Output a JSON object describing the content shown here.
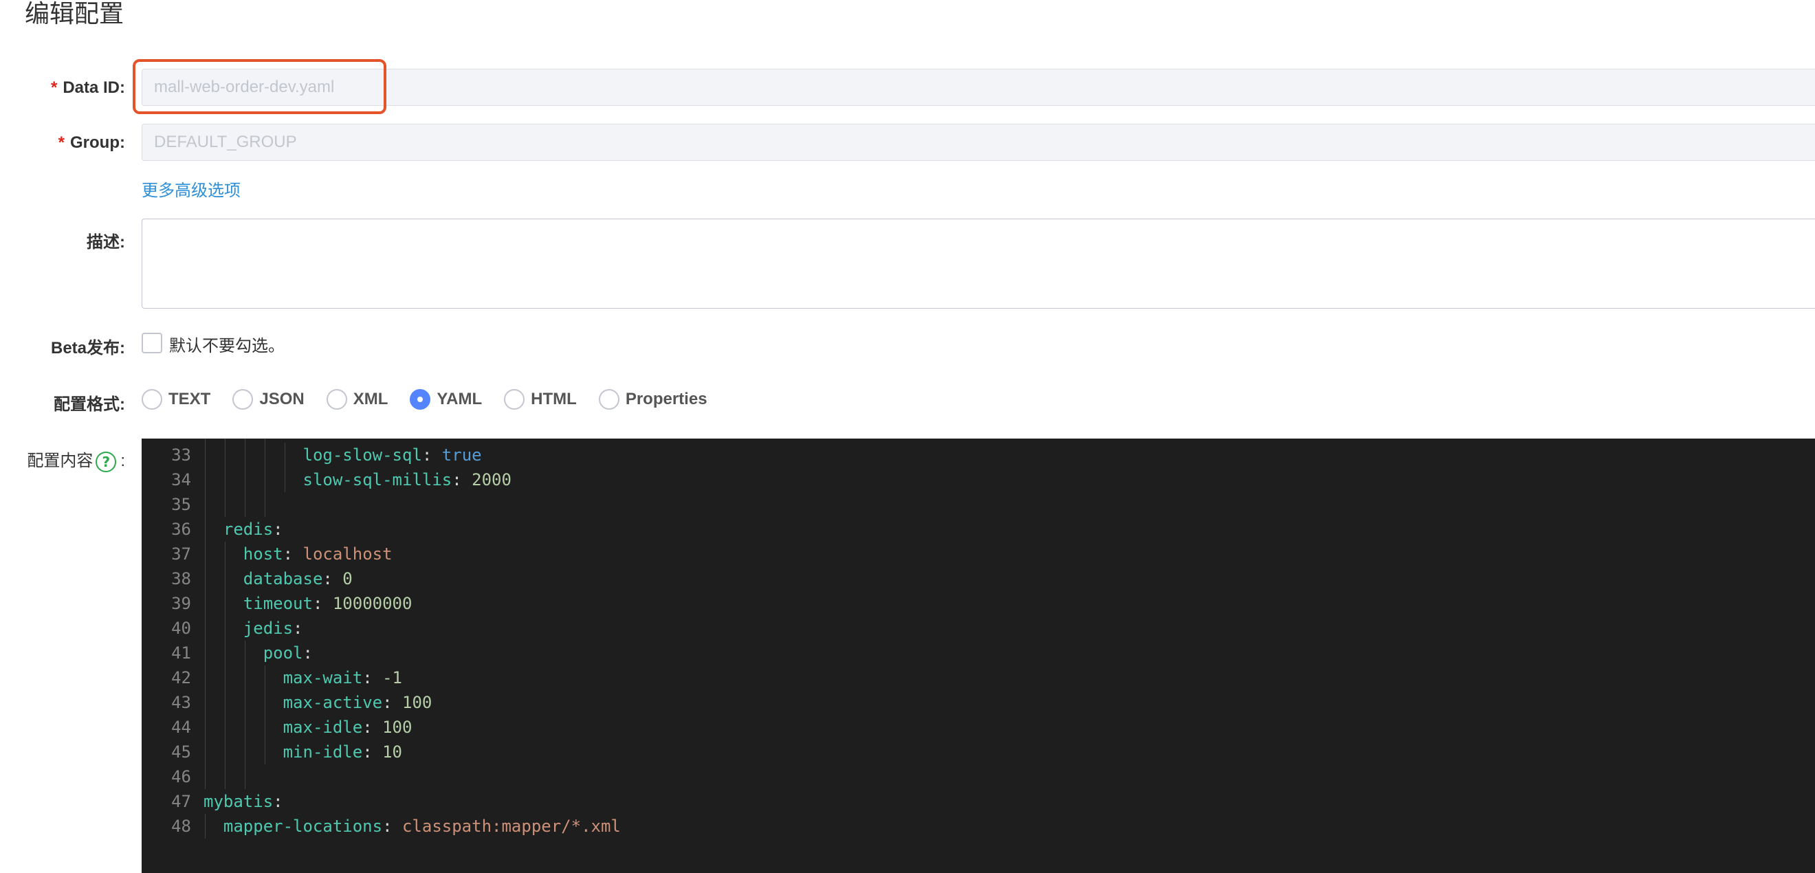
{
  "page": {
    "title": "编辑配置"
  },
  "form": {
    "required_mark": "*",
    "data_id": {
      "label": "Data ID:",
      "value": "mall-web-order-dev.yaml"
    },
    "group": {
      "label": "Group:",
      "value": "DEFAULT_GROUP"
    },
    "advanced_link": "更多高级选项",
    "description": {
      "label": "描述:",
      "value": ""
    },
    "beta": {
      "label": "Beta发布:",
      "checkbox_label": "默认不要勾选。",
      "checked": false
    },
    "format": {
      "label": "配置格式:",
      "options": [
        "TEXT",
        "JSON",
        "XML",
        "YAML",
        "HTML",
        "Properties"
      ],
      "selected": "YAML"
    },
    "content": {
      "label": "配置内容",
      "colon": ":",
      "help_icon_glyph": "?",
      "help_icon": "question-circle-icon"
    }
  },
  "colors": {
    "highlight_border": "#e5532a",
    "link": "#2f8fd7",
    "radio_checked": "#5584ff",
    "required": "#e1241b",
    "editor_bg": "#1e1e1e"
  },
  "editor": {
    "lines": [
      {
        "num": "33",
        "indent": 5,
        "key": "log-slow-sql",
        "sep": ": ",
        "value": "true",
        "vtype": "bool"
      },
      {
        "num": "34",
        "indent": 5,
        "key": "slow-sql-millis",
        "sep": ": ",
        "value": "2000",
        "vtype": "num"
      },
      {
        "num": "35",
        "indent": 0,
        "key": "",
        "sep": "",
        "value": "",
        "vtype": "",
        "guides": 4
      },
      {
        "num": "36",
        "indent": 1,
        "key": "redis",
        "sep": ":",
        "value": "",
        "vtype": ""
      },
      {
        "num": "37",
        "indent": 2,
        "key": "host",
        "sep": ": ",
        "value": "localhost",
        "vtype": "str"
      },
      {
        "num": "38",
        "indent": 2,
        "key": "database",
        "sep": ": ",
        "value": "0",
        "vtype": "num"
      },
      {
        "num": "39",
        "indent": 2,
        "key": "timeout",
        "sep": ": ",
        "value": "10000000",
        "vtype": "num"
      },
      {
        "num": "40",
        "indent": 2,
        "key": "jedis",
        "sep": ":",
        "value": "",
        "vtype": ""
      },
      {
        "num": "41",
        "indent": 3,
        "key": "pool",
        "sep": ":",
        "value": "",
        "vtype": ""
      },
      {
        "num": "42",
        "indent": 4,
        "key": "max-wait",
        "sep": ": ",
        "value": "-1",
        "vtype": "num"
      },
      {
        "num": "43",
        "indent": 4,
        "key": "max-active",
        "sep": ": ",
        "value": "100",
        "vtype": "num"
      },
      {
        "num": "44",
        "indent": 4,
        "key": "max-idle",
        "sep": ": ",
        "value": "100",
        "vtype": "num"
      },
      {
        "num": "45",
        "indent": 4,
        "key": "min-idle",
        "sep": ": ",
        "value": "10",
        "vtype": "num"
      },
      {
        "num": "46",
        "indent": 0,
        "key": "",
        "sep": "",
        "value": "",
        "vtype": "",
        "guides": 3
      },
      {
        "num": "47",
        "indent": 0,
        "key": "mybatis",
        "sep": ":",
        "value": "",
        "vtype": ""
      },
      {
        "num": "48",
        "indent": 1,
        "key": "mapper-locations",
        "sep": ": ",
        "value": "classpath:mapper/*.xml",
        "vtype": "str"
      }
    ]
  }
}
